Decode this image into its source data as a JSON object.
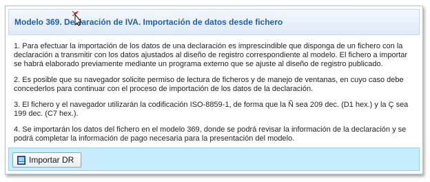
{
  "panel": {
    "title": "Modelo 369. Declaración de IVA. Importación de datos desde fichero",
    "paragraphs": [
      "1. Para efectuar la importación de los datos de una declaración es imprescindible que disponga de un fichero con la declaración a transmitir con los datos ajustados al diseño de registro correspondiente al modelo. El fichero a importar se habrá elaborado previamente mediante un programa externo que se ajuste al diseño de registro publicado.",
      "2. Es posible que su navegador solicite permiso de lectura de ficheros y de manejo de ventanas, en cuyo caso debe concederlos para continuar con el proceso de importación de los datos de la declaración.",
      "3. El fichero y el navegador utilizarán la codificación ISO-8859-1, de forma que la Ñ sea 209 dec. (D1 hex.) y la Ç sea 199 dec. (C7 hex.).",
      "4. Se importarán los datos del fichero en el modelo 369, donde se podrá revisar la información de la declaración y se podrá completar la información de pago necesaria para la presentación del modelo."
    ]
  },
  "footer": {
    "import_button_label": "Importar DR",
    "import_icon": "document-icon"
  },
  "colors": {
    "title": "#1f5fa8",
    "footer_bg": "#c7ecfb",
    "cursor_highlight": "#e00000"
  }
}
